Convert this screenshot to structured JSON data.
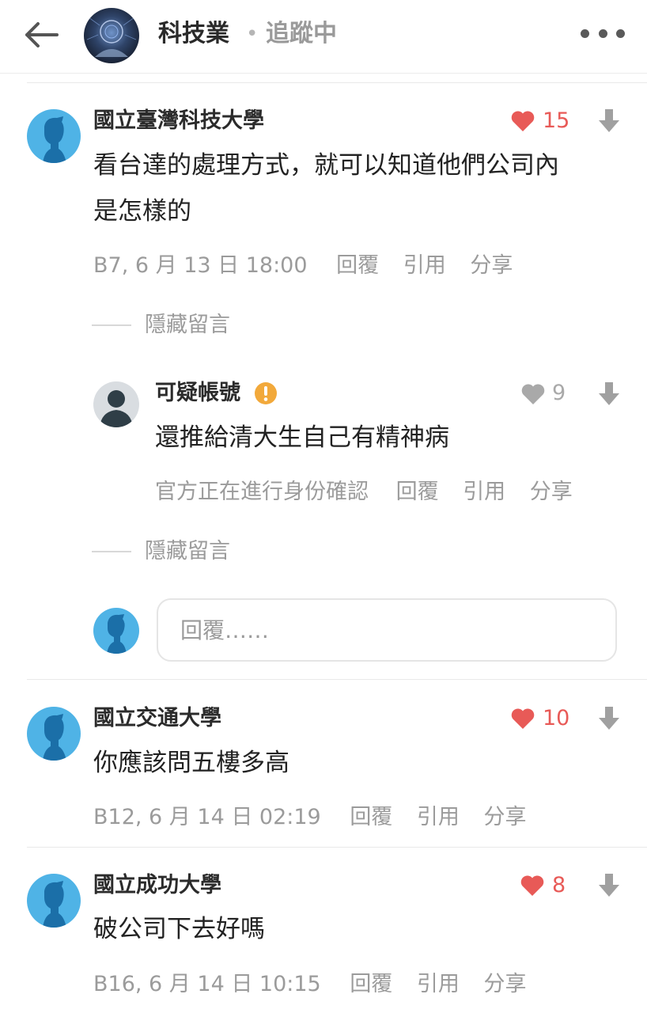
{
  "header": {
    "board_name": "科技業",
    "separator": "•",
    "follow_status": "追蹤中"
  },
  "colors": {
    "heart_liked": "#e85a57",
    "heart_neutral": "#a9a9a9",
    "avatar_blue": "#4fb3e6",
    "warning_badge": "#f2a93b"
  },
  "comment_b7": {
    "author": "國立臺灣科技大學",
    "likes": "15",
    "liked": true,
    "text_line1": "看台達的處理方式，就可以知道他們公司內",
    "text_line2": "是怎樣的",
    "floor_time": "B7, 6 月 13 日 18:00",
    "reply_label": "回覆",
    "quote_label": "引用",
    "share_label": "分享"
  },
  "hide_replies_1": "隱藏留言",
  "nested_reply": {
    "author": "可疑帳號",
    "warning_icon": "exclamation-badge-icon",
    "likes": "9",
    "liked": false,
    "text": "還推給清大生自己有精神病",
    "status": "官方正在進行身份確認",
    "reply_label": "回覆",
    "quote_label": "引用",
    "share_label": "分享"
  },
  "hide_replies_2": "隱藏留言",
  "reply_box": {
    "placeholder": "回覆……"
  },
  "comment_b12": {
    "author": "國立交通大學",
    "likes": "10",
    "liked": true,
    "text": "你應該問五樓多高",
    "floor_time": "B12, 6 月 14 日 02:19",
    "reply_label": "回覆",
    "quote_label": "引用",
    "share_label": "分享"
  },
  "comment_b16": {
    "author": "國立成功大學",
    "likes": "8",
    "liked": true,
    "text": "破公司下去好嗎",
    "floor_time": "B16, 6 月 14 日 10:15",
    "reply_label": "回覆",
    "quote_label": "引用",
    "share_label": "分享"
  }
}
